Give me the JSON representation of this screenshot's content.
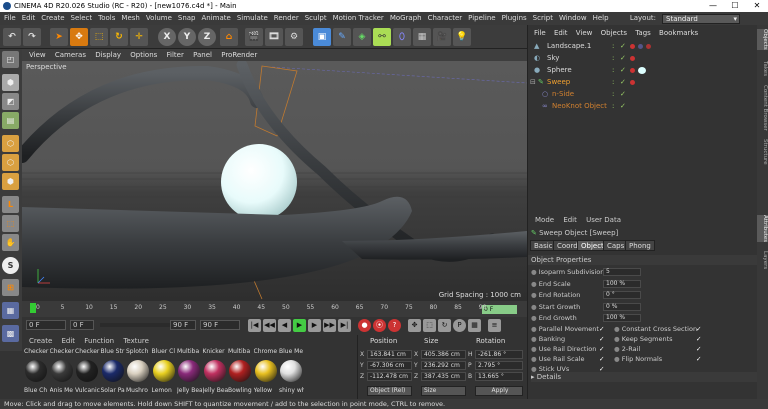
{
  "window": {
    "title": "CINEMA 4D R20.026 Studio (RC - R20) - [new1076.c4d *] - Main",
    "minimize": "—",
    "maximize": "☐",
    "close": "✕"
  },
  "menubar": [
    "File",
    "Edit",
    "Create",
    "Select",
    "Tools",
    "Mesh",
    "Volume",
    "Snap",
    "Animate",
    "Simulate",
    "Render",
    "Sculpt",
    "Motion Tracker",
    "MoGraph",
    "Character",
    "Pipeline",
    "Plugins",
    "Script",
    "Window",
    "Help"
  ],
  "layout": {
    "label": "Layout:",
    "value": "Standard"
  },
  "toolbar": {
    "x": "X",
    "y": "Y",
    "z": "Z"
  },
  "viewport": {
    "menu": [
      "View",
      "Cameras",
      "Display",
      "Options",
      "Filter",
      "Panel",
      "ProRender"
    ],
    "camera": "Perspective",
    "grid_spacing": "Grid Spacing : 1000 cm"
  },
  "timeline": {
    "ticks": [
      "0",
      "5",
      "10",
      "15",
      "20",
      "25",
      "30",
      "35",
      "40",
      "45",
      "50",
      "55",
      "60",
      "65",
      "70",
      "75",
      "80",
      "85",
      "90"
    ],
    "frame_end_label": "0 F"
  },
  "timebar": {
    "start": "0 F",
    "current": "0 F",
    "end_max": "90 F",
    "end": "90 F"
  },
  "materials": {
    "menu": [
      "Create",
      "Edit",
      "Function",
      "Texture"
    ],
    "items": [
      {
        "top": "Checker",
        "bottom": "Blue Ch",
        "color": "#2c2c2c"
      },
      {
        "top": "Checker",
        "bottom": "Anis Me",
        "color": "#3a3a3a"
      },
      {
        "top": "Checker",
        "bottom": "Vulcanic",
        "color": "#222222"
      },
      {
        "top": "Blue Str",
        "bottom": "Solar Pa",
        "color": "#1b2a6a"
      },
      {
        "top": "Splotch",
        "bottom": "Mushro",
        "color": "#d9d0c0"
      },
      {
        "top": "Bluer Cl",
        "bottom": "Lemon",
        "color": "#e8d020"
      },
      {
        "top": "Multiba",
        "bottom": "Jelly Bea",
        "color": "#8a2a7a"
      },
      {
        "top": "Knicker",
        "bottom": "Jelly Bea",
        "color": "#c03060"
      },
      {
        "top": "Multiba",
        "bottom": "Bowling",
        "color": "#b02020"
      },
      {
        "top": "Chrome",
        "bottom": "Yellow",
        "color": "#e8c020"
      },
      {
        "top": "Blue Me",
        "bottom": "shiny wh",
        "color": "#e0e0e0"
      }
    ]
  },
  "coords": {
    "headers": {
      "position": "Position",
      "size": "Size",
      "rotation": "Rotation"
    },
    "rows": [
      {
        "axis": "X",
        "pos": "163.841 cm",
        "size": "405.386 cm",
        "rot_axis": "H",
        "rot": "-261.86 °"
      },
      {
        "axis": "Y",
        "pos": "-67.306 cm",
        "size": "236.292 cm",
        "rot_axis": "P",
        "rot": "2.795 °"
      },
      {
        "axis": "Z",
        "pos": "-112.478 cm",
        "size": "387.435 cm",
        "rot_axis": "B",
        "rot": "13.665 °"
      }
    ],
    "mode": "Object (Rel)",
    "size_mode": "Size",
    "apply": "Apply"
  },
  "objects": {
    "menu": [
      "File",
      "Edit",
      "View",
      "Objects",
      "Tags",
      "Bookmarks"
    ],
    "items": [
      {
        "name": "Landscape.1",
        "color": "#ddd"
      },
      {
        "name": "Sky",
        "color": "#ddd"
      },
      {
        "name": "Sphere",
        "color": "#ddd"
      },
      {
        "name": "Sweep",
        "color": "#f0a030"
      },
      {
        "name": "n-Side",
        "color": "#d08030"
      },
      {
        "name": "NeoKnot Object",
        "color": "#d08030"
      }
    ]
  },
  "attributes": {
    "menu": [
      "Mode",
      "Edit",
      "User Data"
    ],
    "title": "Sweep Object [Sweep]",
    "tabs": [
      "Basic",
      "Coord.",
      "Object",
      "Caps",
      "Phong"
    ],
    "section": "Object Properties",
    "props": [
      {
        "label": "Isoparm Subdivision",
        "value": "5"
      },
      {
        "label": "End Scale",
        "value": "100 %"
      },
      {
        "label": "End Rotation",
        "value": "0 °"
      },
      {
        "label": "Start Growth",
        "value": "0 %"
      },
      {
        "label": "End Growth",
        "value": "100 %"
      }
    ],
    "checks_left": [
      "Parallel Movement",
      "Banking",
      "Use Rail Direction",
      "Use Rail Scale",
      "Stick UVs"
    ],
    "checks_right": [
      "Constant Cross Section",
      "Keep Segments",
      "2-Rail",
      "Flip Normals"
    ],
    "details": "Details"
  },
  "sidetabs": [
    "Objects",
    "Takes",
    "Content Browser",
    "Structure",
    "Attributes",
    "Layers"
  ],
  "status": "Move: Click and drag to move elements. Hold down SHIFT to quantize movement / add to the selection in point mode, CTRL to remove."
}
